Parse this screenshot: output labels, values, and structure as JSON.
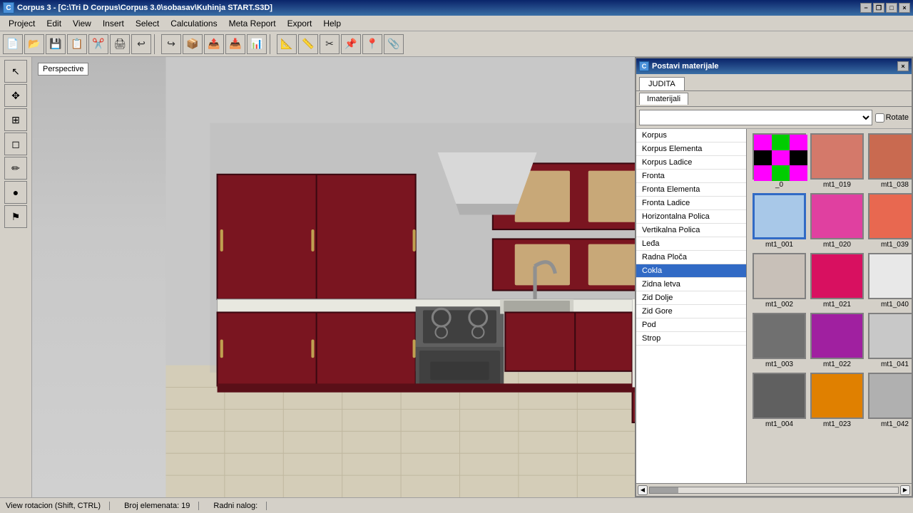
{
  "titleBar": {
    "appIcon": "C",
    "title": "Corpus 3 - [C:\\Tri D Corpus\\Corpus 3.0\\sobasav\\Kuhinja START.S3D]",
    "minimizeLabel": "−",
    "maximizeLabel": "□",
    "closeLabel": "×",
    "restoreLabel": "❐"
  },
  "menuBar": {
    "items": [
      "Project",
      "Edit",
      "View",
      "Insert",
      "Select",
      "Calculations",
      "Meta Report",
      "Export",
      "Help"
    ]
  },
  "toolbar": {
    "buttons": [
      "📄",
      "📂",
      "💾",
      "📋",
      "✂️",
      "🖨",
      "↩",
      "🔄",
      "📦",
      "📦",
      "📦",
      "📦",
      "📦",
      "📦",
      "📦",
      "📦",
      "📦",
      "📦"
    ]
  },
  "leftSidebar": {
    "tools": [
      "↖",
      "✥",
      "⊞",
      "⊟",
      "✏",
      "🔴",
      "⚑"
    ]
  },
  "viewport": {
    "perspectiveLabel": "Perspective",
    "statusMessage": "View rotacion (Shift, CTRL)"
  },
  "materialDialog": {
    "title": "Postavi materijale",
    "icon": "C",
    "closeBtn": "×",
    "tabs": [
      {
        "label": "JUDITA",
        "active": true
      }
    ],
    "subTabs": [
      {
        "label": "Imaterijali",
        "active": true
      }
    ],
    "dropdownValue": "",
    "rotateLabel": "Rotate",
    "listItems": [
      {
        "label": "Korpus",
        "selected": false
      },
      {
        "label": "Korpus Elementa",
        "selected": false
      },
      {
        "label": "Korpus Ladice",
        "selected": false
      },
      {
        "label": "Fronta",
        "selected": false
      },
      {
        "label": "Fronta Elementa",
        "selected": false
      },
      {
        "label": "Fronta Ladice",
        "selected": false
      },
      {
        "label": "Horizontalna Polica",
        "selected": false
      },
      {
        "label": "Vertikalna Polica",
        "selected": false
      },
      {
        "label": "Leđa",
        "selected": false
      },
      {
        "label": "Radna Ploča",
        "selected": false
      },
      {
        "label": "Cokla",
        "selected": true
      },
      {
        "label": "Zidna letva",
        "selected": false
      },
      {
        "label": "Zid Dolje",
        "selected": false
      },
      {
        "label": "Zid Gore",
        "selected": false
      },
      {
        "label": "Pod",
        "selected": false
      },
      {
        "label": "Strop",
        "selected": false
      }
    ],
    "colorSwatches": [
      {
        "id": "_0",
        "label": "_0",
        "color": "pattern",
        "selected": false
      },
      {
        "id": "mt1_019",
        "label": "mt1_019",
        "color": "#d4796a",
        "selected": false
      },
      {
        "id": "mt1_038",
        "label": "mt1_038",
        "color": "#c96a50",
        "selected": false
      },
      {
        "id": "mt1_001",
        "label": "mt1_001",
        "color": "#a8c8e8",
        "selected": true
      },
      {
        "id": "mt1_020",
        "label": "mt1_020",
        "color": "#e040a0",
        "selected": false
      },
      {
        "id": "mt1_039",
        "label": "mt1_039",
        "color": "#e86850",
        "selected": false
      },
      {
        "id": "mt1_002",
        "label": "mt1_002",
        "color": "#c8c0b8",
        "selected": false
      },
      {
        "id": "mt1_021",
        "label": "mt1_021",
        "color": "#d81060",
        "selected": false
      },
      {
        "id": "mt1_040",
        "label": "mt1_040",
        "color": "#e8e8e8",
        "selected": false
      },
      {
        "id": "mt1_003",
        "label": "mt1_003",
        "color": "#707070",
        "selected": false
      },
      {
        "id": "mt1_022",
        "label": "mt1_022",
        "color": "#a020a0",
        "selected": false
      },
      {
        "id": "mt1_041",
        "label": "mt1_041",
        "color": "#c8c8c8",
        "selected": false
      },
      {
        "id": "mt1_004",
        "label": "mt1_004",
        "color": "#606060",
        "selected": false
      },
      {
        "id": "mt1_023",
        "label": "mt1_023",
        "color": "#e08000",
        "selected": false
      },
      {
        "id": "mt1_042",
        "label": "mt1_042",
        "color": "#b0b0b0",
        "selected": false
      }
    ]
  },
  "statusBar": {
    "viewInfo": "View rotacion (Shift, CTRL)",
    "elementCount": "Broj elemenata: 19",
    "orderLabel": "Radni nalog:"
  }
}
